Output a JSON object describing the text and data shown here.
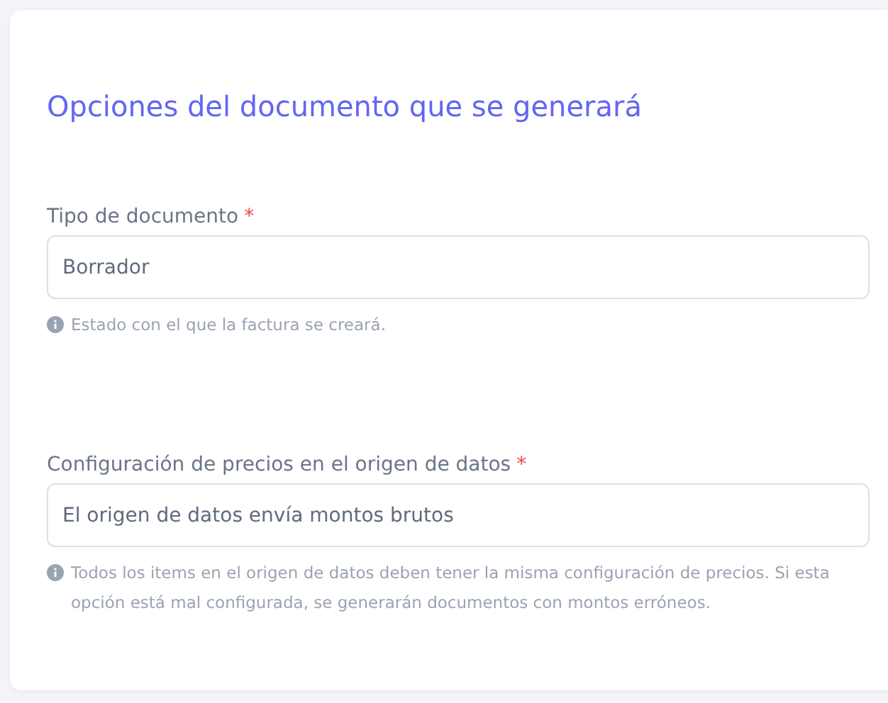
{
  "section_title": "Opciones del documento que se generará",
  "fields": [
    {
      "label": "Tipo de documento",
      "required_mark": "*",
      "value": "Borrador",
      "help": "Estado con el que la factura se creará."
    },
    {
      "label": "Configuración de precios en el origen de datos",
      "required_mark": "*",
      "value": "El origen de datos envía montos brutos",
      "help": "Todos los items en el origen de datos deben tener la misma configuración de precios. Si esta opción está mal configurada, se generarán documentos con montos erróneos."
    }
  ]
}
